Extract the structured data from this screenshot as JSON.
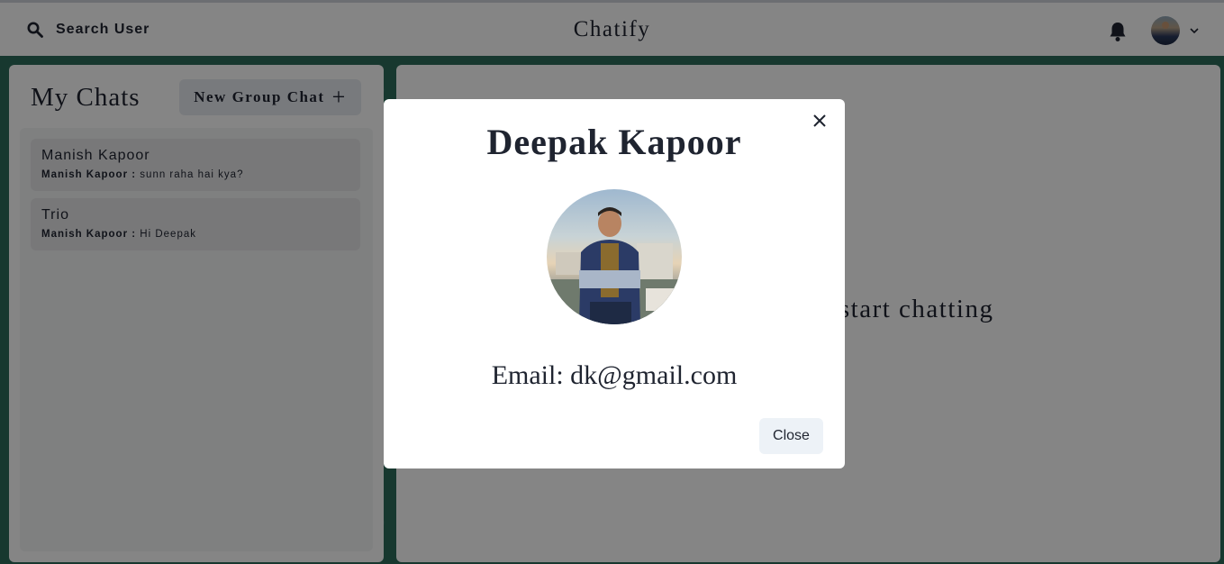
{
  "app": {
    "title": "Chatify"
  },
  "header": {
    "search_label": "Search User"
  },
  "sidebar": {
    "heading": "My Chats",
    "new_group_label": "New Group Chat",
    "chats": [
      {
        "name": "Manish Kapoor",
        "sender": "Manish Kapoor :",
        "message": "sunn raha hai kya?"
      },
      {
        "name": "Trio",
        "sender": "Manish Kapoor :",
        "message": "Hi Deepak"
      }
    ]
  },
  "main": {
    "hint": "Click on a user to start chatting"
  },
  "modal": {
    "title": "Deepak Kapoor",
    "email": "Email: dk@gmail.com",
    "close_label": "Close"
  },
  "icons": {
    "search": "search-icon",
    "bell": "bell-icon",
    "chevron": "chevron-down-icon",
    "close": "close-icon",
    "plus": "plus-icon"
  },
  "colors": {
    "wallpaper": "#2c6b5a",
    "text": "#1f2430",
    "button_bg": "#edf2f7"
  }
}
